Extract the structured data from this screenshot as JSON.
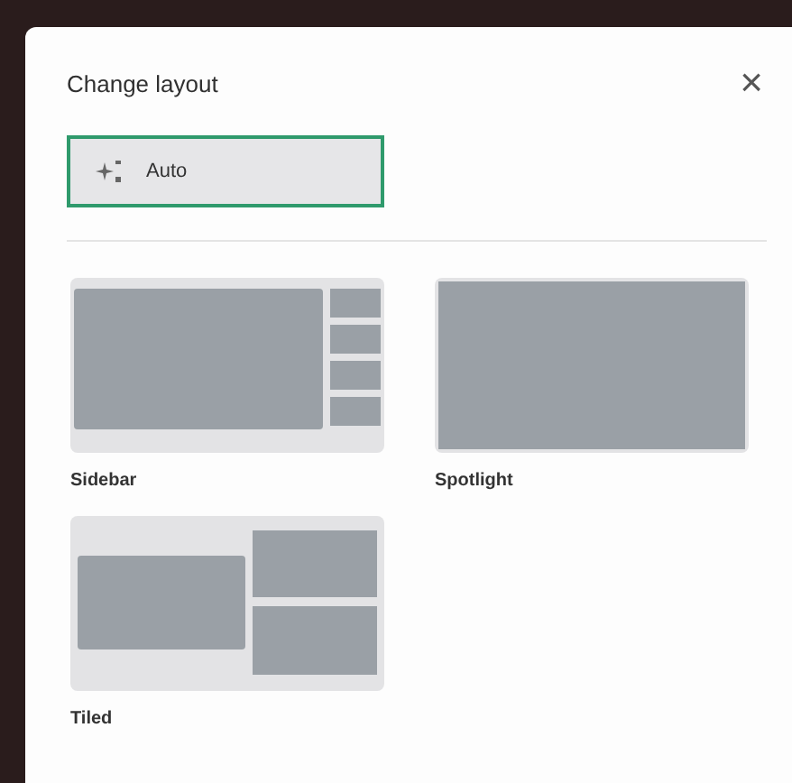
{
  "dialog": {
    "title": "Change layout",
    "close": "×"
  },
  "auto": {
    "label": "Auto",
    "selected": true
  },
  "layouts": [
    {
      "kind": "sidebar",
      "label": "Sidebar",
      "selected": false
    },
    {
      "kind": "spotlight",
      "label": "Spotlight",
      "selected": false
    },
    {
      "kind": "tiled",
      "label": "Tiled",
      "selected": false
    }
  ]
}
